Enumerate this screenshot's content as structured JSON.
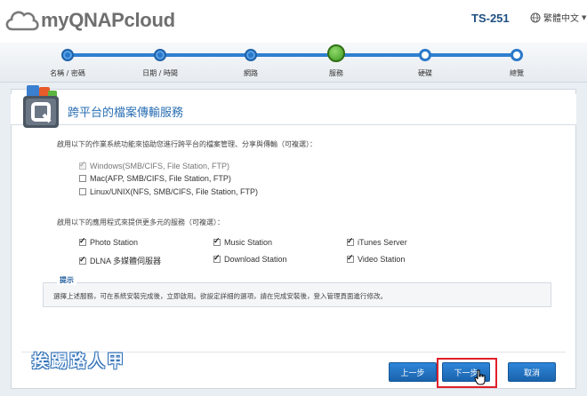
{
  "header": {
    "brand": "myQNAPcloud",
    "device": "TS-251",
    "language": "繁體中文"
  },
  "steps": [
    {
      "label": "名稱 / 密碼",
      "state": "done"
    },
    {
      "label": "日期 / 時間",
      "state": "done"
    },
    {
      "label": "網路",
      "state": "done"
    },
    {
      "label": "服務",
      "state": "current"
    },
    {
      "label": "硬碟",
      "state": "todo"
    },
    {
      "label": "總覽",
      "state": "todo"
    }
  ],
  "panel": {
    "title": "跨平台的檔案傳輸服務",
    "os_intro": "啟用以下的作業系統功能來協助您進行跨平台的檔案管理、分享與傳輸（可複選）：",
    "os_options": [
      {
        "label": "Windows(SMB/CIFS, File Station, FTP)",
        "checked": true,
        "disabled": true
      },
      {
        "label": "Mac(AFP, SMB/CIFS, File Station, FTP)",
        "checked": false,
        "disabled": false
      },
      {
        "label": "Linux/UNIX(NFS, SMB/CIFS, File Station, FTP)",
        "checked": false,
        "disabled": false
      }
    ],
    "app_intro": "啟用以下的應用程式來提供更多元的服務（可複選）：",
    "app_options": [
      {
        "label": "Photo Station",
        "checked": true
      },
      {
        "label": "Music Station",
        "checked": true
      },
      {
        "label": "iTunes Server",
        "checked": true
      },
      {
        "label": "DLNA 多媒體伺服器",
        "checked": true
      },
      {
        "label": "Download Station",
        "checked": true
      },
      {
        "label": "Video Station",
        "checked": true
      }
    ],
    "hint_label": "提示",
    "hint_text": "選擇上述服務，可在系統安裝完成後，立即啟用。欲設定詳細的選項，請在完成安裝後，登入管理頁面進行修改。"
  },
  "watermark": "挨踢路人甲",
  "buttons": {
    "prev": "上一步",
    "next": "下一步",
    "cancel": "取消"
  },
  "colors": {
    "accent": "#2a78c9",
    "current_step": "#3e9a1f",
    "highlight": "#e0202a"
  }
}
